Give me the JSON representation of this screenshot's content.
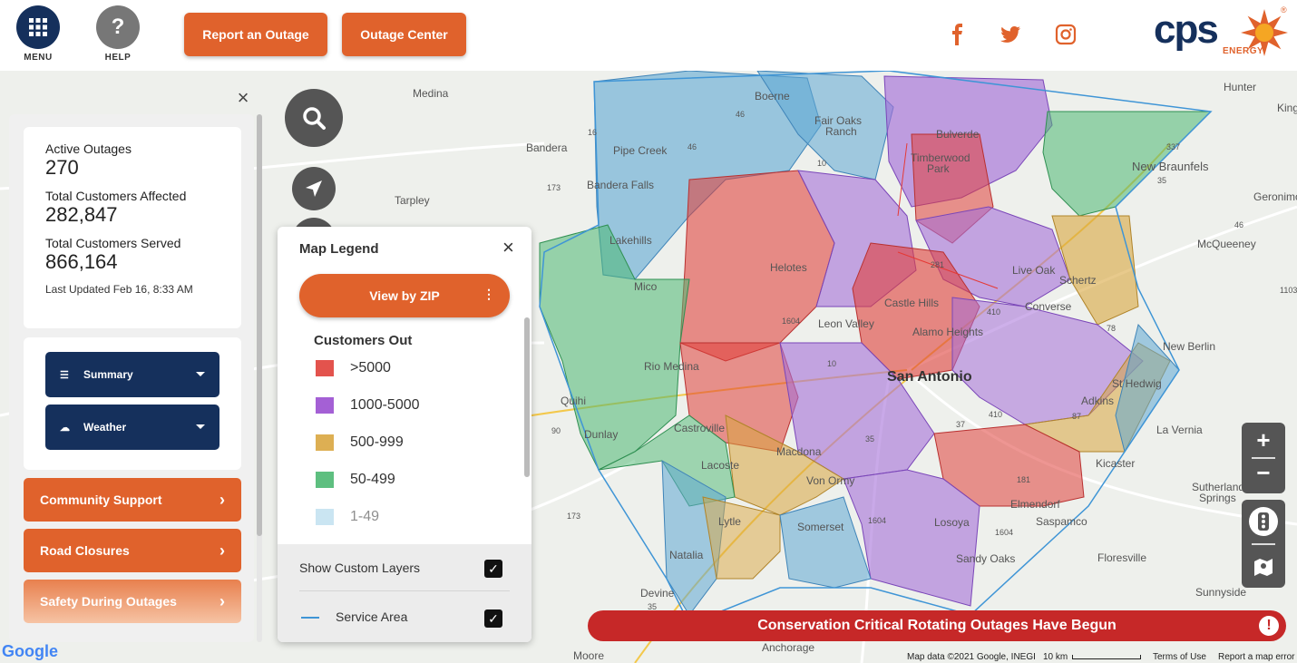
{
  "header": {
    "menu_label": "MENU",
    "help_label": "HELP",
    "report_outage": "Report an Outage",
    "outage_center": "Outage Center",
    "social_icons": [
      "facebook-icon",
      "twitter-icon",
      "instagram-icon"
    ],
    "brand_text": "cps",
    "brand_sub": "ENERGY",
    "brand_mark": "®",
    "brand_color": "#15305c",
    "accent_color": "#e0622c"
  },
  "stats": {
    "active_label": "Active Outages",
    "active_value": "270",
    "affected_label": "Total Customers Affected",
    "affected_value": "282,847",
    "served_label": "Total Customers Served",
    "served_value": "866,164",
    "updated": "Last Updated  Feb 16, 8:33 AM"
  },
  "selects": {
    "summary": "Summary",
    "weather": "Weather"
  },
  "links": {
    "community": "Community Support",
    "road": "Road Closures",
    "safety": "Safety During Outages"
  },
  "legend": {
    "title": "Map Legend",
    "view_zip": "View by ZIP",
    "customers_out": "Customers Out",
    "items": [
      {
        "label": ">5000",
        "color": "#e0403a"
      },
      {
        "label": "1000-5000",
        "color": "#9a4fd0"
      },
      {
        "label": "500-999",
        "color": "#d9a640"
      },
      {
        "label": "50-499",
        "color": "#4cb872"
      },
      {
        "label": "1-49",
        "color": "#9fd0e8"
      }
    ],
    "custom_layers": "Show Custom Layers",
    "service_area": "Service Area"
  },
  "banner": "Conservation Critical Rotating Outages Have Begun",
  "map_labels": {
    "medina": "Medina",
    "boerne": "Boerne",
    "fair_oaks": "Fair Oaks",
    "ranch": "Ranch",
    "bandera": "Bandera",
    "pipe_creek": "Pipe Creek",
    "bulverde": "Bulverde",
    "tarpley": "Tarpley",
    "bandera_falls": "Bandera Falls",
    "timberwood": "Timberwood",
    "park": "Park",
    "new_braunfels": "New Braunfels",
    "geronimo": "Geronimo",
    "lakehills": "Lakehills",
    "helotes": "Helotes",
    "live_oak": "Live Oak",
    "schertz": "Schertz",
    "mcqueeney": "McQueeney",
    "mico": "Mico",
    "castle_hills": "Castle Hills",
    "converse": "Converse",
    "leon_valley": "Leon Valley",
    "alamo_heights": "Alamo Heights",
    "new_berlin": "New Berlin",
    "rio_medina": "Rio Medina",
    "san_antonio": "San Antonio",
    "st_hedwig": "St Hedwig",
    "quihi": "Quihi",
    "adkins": "Adkins",
    "castroville": "Castroville",
    "dunlay": "Dunlay",
    "la_vernia": "La Vernia",
    "macdona": "Macdona",
    "kicaster": "Kicaster",
    "lacoste": "Lacoste",
    "von_ormy": "Von Ormy",
    "sutherland": "Sutherland",
    "springs": "Springs",
    "elmendorf": "Elmendorf",
    "lytle": "Lytle",
    "somerset": "Somerset",
    "saspamco": "Saspamco",
    "losoya": "Losoya",
    "natalia": "Natalia",
    "sandy_oaks": "Sandy Oaks",
    "floresville": "Floresville",
    "devine": "Devine",
    "sunnyside": "Sunnyside",
    "moore": "Moore",
    "anchorage": "Anchorage",
    "hunter": "Hunter",
    "kingsbury": "Kingsbury",
    "hw_46a": "46",
    "hw_16": "16",
    "hw_46b": "46",
    "hw_173a": "173",
    "hw_10a": "10",
    "hw_281": "281",
    "hw_1604a": "1604",
    "hw_410a": "410",
    "hw_10b": "10",
    "hw_37": "37",
    "hw_410b": "410",
    "hw_35a": "35",
    "hw_87": "87",
    "hw_181": "181",
    "hw_1604b": "1604",
    "hw_1604c": "1604",
    "hw_173b": "173",
    "hw_35b": "35",
    "hw_90": "90",
    "hw_337": "337",
    "hw_78": "78",
    "hw_46c": "46",
    "hw_1103": "1103",
    "hw_35c": "35"
  },
  "footer": {
    "google": "Google",
    "map_data": "Map data ©2021 Google, INEGI",
    "scale": "10 km",
    "terms": "Terms of Use",
    "report_error": "Report a map error"
  }
}
